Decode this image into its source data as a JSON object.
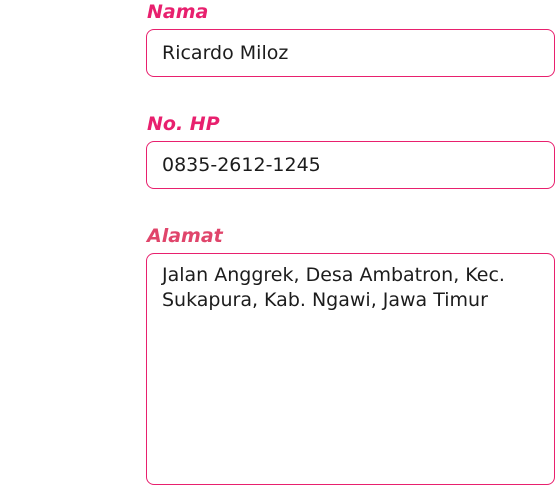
{
  "form": {
    "name": {
      "label": "Nama",
      "value": "Ricardo Miloz"
    },
    "phone": {
      "label": "No. HP",
      "value": "0835-2612-1245"
    },
    "address": {
      "label": "Alamat",
      "value": "Jalan Anggrek, Desa Ambatron, Kec. Sukapura, Kab. Ngawi, Jawa Timur"
    }
  },
  "colors": {
    "accent": "#e8206e",
    "accent_alt": "#e0456b",
    "text": "#1c1c1c",
    "background": "#ffffff"
  }
}
